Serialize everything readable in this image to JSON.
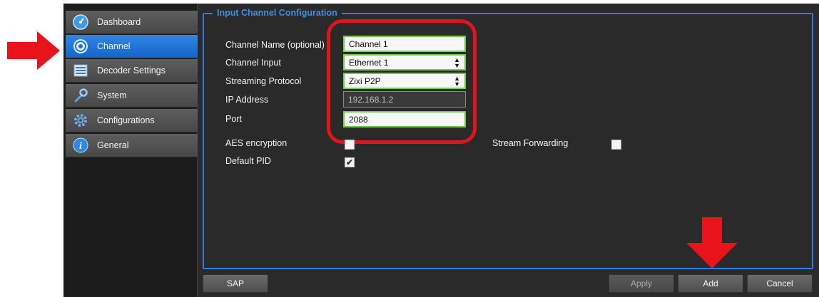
{
  "sidebar": {
    "items": [
      {
        "label": "Dashboard",
        "icon": "dashboard-icon",
        "active": false
      },
      {
        "label": "Channel",
        "icon": "channel-icon",
        "active": true
      },
      {
        "label": "Decoder Settings",
        "icon": "decoder-settings-icon",
        "active": false
      },
      {
        "label": "System",
        "icon": "wrench-icon",
        "active": false
      },
      {
        "label": "Configurations",
        "icon": "gear-icon",
        "active": false
      },
      {
        "label": "General",
        "icon": "info-icon",
        "active": false
      }
    ]
  },
  "panel": {
    "title": "Input Channel Configuration",
    "channel_name": {
      "label": "Channel Name (optional)",
      "value": "Channel 1"
    },
    "channel_input": {
      "label": "Channel Input",
      "value": "Ethernet 1"
    },
    "streaming_protocol": {
      "label": "Streaming Protocol",
      "value": "Zixi P2P"
    },
    "ip_address": {
      "label": "IP Address",
      "value": "192.168.1.2"
    },
    "port": {
      "label": "Port",
      "value": "2088"
    },
    "aes_encryption": {
      "label": "AES encryption",
      "checked": false
    },
    "stream_forwarding": {
      "label": "Stream Forwarding",
      "checked": false
    },
    "default_pid": {
      "label": "Default PID",
      "checked": true
    }
  },
  "buttons": {
    "sap": "SAP",
    "apply": "Apply",
    "add": "Add",
    "cancel": "Cancel"
  },
  "colors": {
    "accent": "#2f7be0",
    "active_nav": "#1f6fd6",
    "field_border": "#6fcf4a",
    "annotation": "#e0141c"
  }
}
